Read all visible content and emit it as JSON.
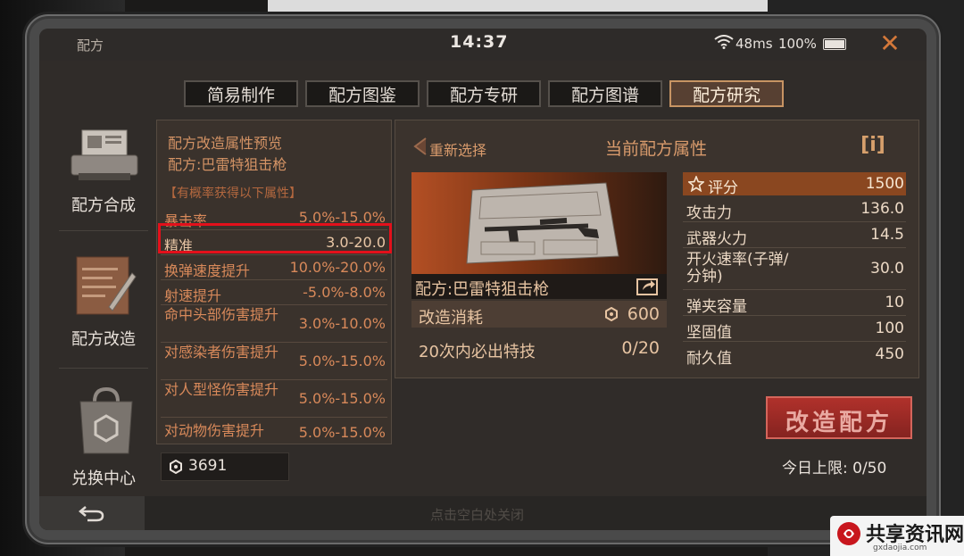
{
  "status": {
    "title": "配方",
    "time": "14:37",
    "ping": "48ms",
    "battery": "100%"
  },
  "tabs": [
    {
      "label": "简易制作"
    },
    {
      "label": "配方图鉴"
    },
    {
      "label": "配方专研"
    },
    {
      "label": "配方图谱"
    },
    {
      "label": "配方研究",
      "active": true
    }
  ],
  "sidebar": [
    {
      "label": "配方合成"
    },
    {
      "label": "配方改造"
    },
    {
      "label": "兑换中心"
    }
  ],
  "preview": {
    "heading": "配方改造属性预览",
    "recipe": "配方:巴雷特狙击枪",
    "note": "【有概率获得以下属性】",
    "rows": [
      {
        "name": "暴击率",
        "value": "5.0%-15.0%"
      },
      {
        "name": "精准",
        "value": "3.0-20.0",
        "highlight": true
      },
      {
        "name": "换弹速度提升",
        "value": "10.0%-20.0%"
      },
      {
        "name": "射速提升",
        "value": "-5.0%-8.0%"
      },
      {
        "name": "命中头部伤害提升",
        "value": "3.0%-10.0%"
      },
      {
        "name": "对感染者伤害提升",
        "value": "5.0%-15.0%"
      },
      {
        "name": "对人型怪伤害提升",
        "value": "5.0%-15.0%"
      },
      {
        "name": "对动物伤害提升",
        "value": "5.0%-15.0%"
      }
    ]
  },
  "currency": {
    "value": "3691"
  },
  "main": {
    "reselect": "重新选择",
    "title": "当前配方属性",
    "info": "i",
    "weapon_name": "配方:巴雷特狙击枪",
    "cost_label": "改造消耗",
    "cost_value": "600",
    "guarantee_label": "20次内必出特技",
    "guarantee_value": "0/20",
    "attributes": [
      {
        "name": "评分",
        "value": "1500"
      },
      {
        "name": "攻击力",
        "value": "136.0"
      },
      {
        "name": "武器火力",
        "value": "14.5"
      },
      {
        "name": "开火速率(子弹/分钟)",
        "value": "30.0"
      },
      {
        "name": "弹夹容量",
        "value": "10"
      },
      {
        "name": "坚固值",
        "value": "100"
      },
      {
        "name": "耐久值",
        "value": "450"
      }
    ]
  },
  "reform_button": "改造配方",
  "daily_limit": "今日上限:  0/50",
  "tap_to_close": "点击空白处关闭",
  "watermark": {
    "text": "共享资讯网",
    "sub": "gxdaojia.com"
  },
  "colors": {
    "accent": "#d99b6c",
    "button_red": "#b0312b",
    "highlight_box": "#e3101b"
  }
}
